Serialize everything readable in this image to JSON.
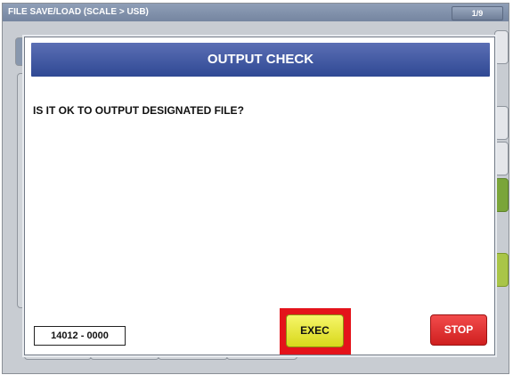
{
  "header": {
    "title": "FILE SAVE/LOAD (SCALE > USB)",
    "page_indicator": "1/9"
  },
  "dialog": {
    "title": "OUTPUT CHECK",
    "message": "IS IT OK TO OUTPUT DESIGNATED FILE?",
    "file_code": "14012 - 0000",
    "exec_label": "EXEC",
    "stop_label": "STOP"
  },
  "colors": {
    "header_bar": "#7f8fa9",
    "dialog_header": "#3a519e",
    "exec_button": "#e8e83a",
    "exec_highlight": "#e4131b",
    "stop_button": "#e03333"
  }
}
